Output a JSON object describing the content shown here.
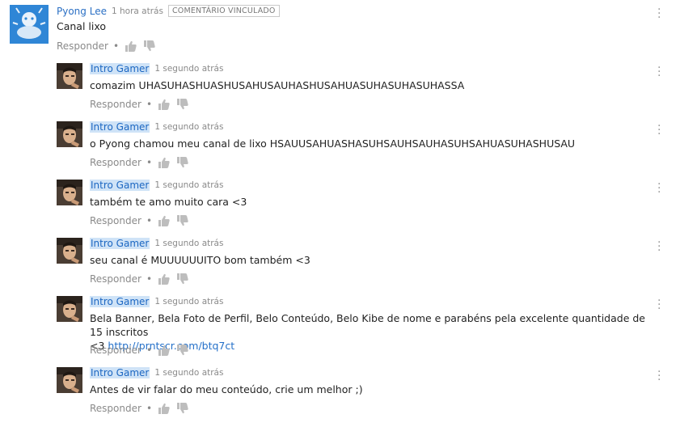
{
  "top_comment": {
    "author": "Pyong Lee",
    "time": "1 hora atrás",
    "badge": "COMENTÁRIO VINCULADO",
    "text": "Canal lixo",
    "reply_label": "Responder",
    "dot": "•"
  },
  "replies": [
    {
      "author": "Intro Gamer",
      "time": "1 segundo atrás",
      "text": "comazim UHASUHASHUASHUSAHUSAUHASHUSAHUASUHASUHASUHASSA",
      "reply_label": "Responder",
      "dot": "•"
    },
    {
      "author": "Intro Gamer",
      "time": "1 segundo atrás",
      "text": "o Pyong chamou meu canal de lixo HSAUUSAHUASHASUHSAUHSAUHASUHSAHUASUHASHUSAU",
      "reply_label": "Responder",
      "dot": "•"
    },
    {
      "author": "Intro Gamer",
      "time": "1 segundo atrás",
      "text": "também te amo muito cara <3",
      "reply_label": "Responder",
      "dot": "•"
    },
    {
      "author": "Intro Gamer",
      "time": "1 segundo atrás",
      "text": "seu canal é MUUUUUUITO bom também <3",
      "reply_label": "Responder",
      "dot": "•"
    },
    {
      "author": "Intro Gamer",
      "time": "1 segundo atrás",
      "text_line1": "Bela Banner, Bela Foto de Perfil, Belo Conteúdo, Belo Kibe de nome e parabéns pela excelente quantidade de 15 inscritos",
      "text_line2_prefix": "<3",
      "link": "http://prntscr.com/btq7ct",
      "reply_label": "Responder",
      "dot": "•"
    },
    {
      "author": "Intro Gamer",
      "time": "1 segundo atrás",
      "text": "Antes de vir falar do meu conteúdo, crie um melhor ;)",
      "reply_label": "Responder",
      "dot": "•"
    }
  ],
  "icons": {
    "like": "thumbs-up-icon",
    "dislike": "thumbs-down-icon",
    "menu": "vertical-dots-icon"
  },
  "colors": {
    "author_link": "#2a6fc4",
    "highlight": "#cfe3f7",
    "muted": "#8a8a8a"
  }
}
